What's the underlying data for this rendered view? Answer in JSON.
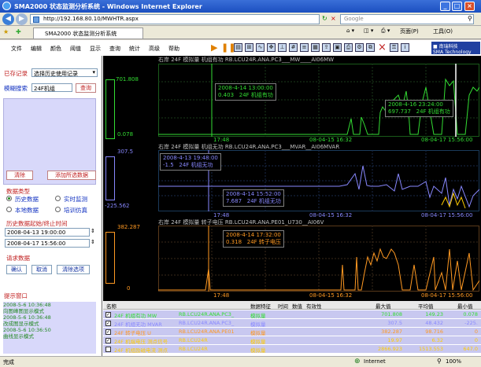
{
  "window": {
    "title": "SMA2000 状态监测分析系统 - Windows Internet Explorer",
    "address": "http://192.168.80.10/MWHTR.aspx",
    "search_placeholder": "Google",
    "tab_label": "SMA2000 状态监测分析系统",
    "toolbar_page": "页面(P)",
    "toolbar_tools": "工具(O)"
  },
  "menu": [
    "文件",
    "编辑",
    "颜色",
    "阈值",
    "显示",
    "查询",
    "统计",
    "高级",
    "帮助"
  ],
  "left": {
    "saved_label": "已存记录",
    "saved_select": "选择历史使用记录",
    "fuzzy_label": "模糊搜索",
    "fuzzy_value": "24F机组",
    "search_button": "查询",
    "clear_button": "清除",
    "add_button": "添加所选数据",
    "datatype_label": "数据类型",
    "radio_history": "历史数据",
    "radio_realtime": "实时监测",
    "radio_local": "本地数据",
    "radio_train": "培训仿真",
    "range_label": "历史数据起始/终止时间",
    "start_time": "2008-04-13 19:00:00",
    "end_time": "2008-04-17 15:56:00",
    "request_label": "请求数据",
    "confirm_button": "确认",
    "cancel_button": "取消",
    "clear_options_button": "清除选项",
    "log_label": "提示窗口",
    "log_lines": [
      "2008-5-6 10:36:48",
      "向图峰图显示模式",
      "2008-5-6 10:36:48",
      "改成图显示模式",
      "2008-5-6 10:36:50",
      "曲线显示模式"
    ]
  },
  "charts": [
    {
      "title": "右岸   24F 模拟量   机组有功 RB.LCU24R.ANA.PC3___MW____AI06MW",
      "ymax": "701.808",
      "ymin": "0.078",
      "x_start": "17:48",
      "x_end1": "08-04-15 16:32",
      "x_end2": "08-04-17 15:56:00",
      "tip1": [
        "2008-4-14 13:00:00",
        "0.403",
        "24F 机组有功"
      ],
      "tip2": [
        "2008-4-16 23:24:00",
        "697.737",
        "24F 机组有功"
      ],
      "color": "#33dd33"
    },
    {
      "title": "右岸   24F 模拟量   机组无功 RB.LCU24R.ANA.PC3___MVAR__AI06MVAR",
      "ymax": "307.5",
      "ymin": "-225.562",
      "x_start": "17:48",
      "x_end1": "08-04-15 16:32",
      "x_end2": "08-04-17 15:56:00",
      "tip1": [
        "2008-4-13 19:48:00",
        "-1.5",
        "24F 机组无功"
      ],
      "tip2": [
        "2008-4-14 15:52:00",
        "7.687",
        "24F 机组无功"
      ],
      "color": "#8888ff"
    },
    {
      "title": "右岸   24F 模拟量   转子电压 RB.LCU24R.ANA.PE01_U730__AI06V",
      "ymax": "382.287",
      "ymin": "0",
      "x_start": "17:48",
      "x_end1": "08-04-15 16:32",
      "x_end2": "08-04-17 15:56:00",
      "tip1": [
        "2008-4-14 17:32:00",
        "0.318",
        "24F 转子电压"
      ],
      "color": "#ff9922"
    }
  ],
  "table": {
    "headers": [
      "名称",
      "数据特征",
      "时间",
      "数值",
      "有效性",
      "最大值",
      "平均值",
      "最小值"
    ],
    "rows": [
      {
        "checked": true,
        "name": "24F 机组有功 MW",
        "tag": "RB.LCU24R.ANA.PC3_",
        "feature": "模拟量",
        "max": "701.808",
        "avg": "149.23",
        "min": "0.078",
        "color": "#33dd33"
      },
      {
        "checked": true,
        "name": "24F 机组无功 MVAR",
        "tag": "RB.LCU24R.ANA.PC3_",
        "feature": "模拟量",
        "max": "307.5",
        "avg": "48.432",
        "min": "-225.",
        "color": "#8888ff"
      },
      {
        "checked": true,
        "name": "24F 转子电压 U",
        "tag": "RB.LCU24R.ANA.PE01",
        "feature": "模拟量",
        "max": "382.287",
        "avg": "98.716",
        "min": "0",
        "color": "#ff9922"
      },
      {
        "checked": true,
        "name": "24F 机端电压 测点信号 ",
        "tag": "RB.LCU24R",
        "feature": "模拟量",
        "max": "19.97",
        "avg": "6.32",
        "min": "0",
        "color": "#ffcc00"
      },
      {
        "checked": false,
        "name": "24F 机组励磁电流 测点",
        "tag": "RB.LCU24R",
        "feature": "模拟量",
        "max": "2866.923",
        "avg": "1513.553",
        "min": "647.0",
        "color": "#ffcc00"
      }
    ]
  },
  "status": {
    "left": "完成",
    "zone": "Internet",
    "zoom": "100%"
  }
}
